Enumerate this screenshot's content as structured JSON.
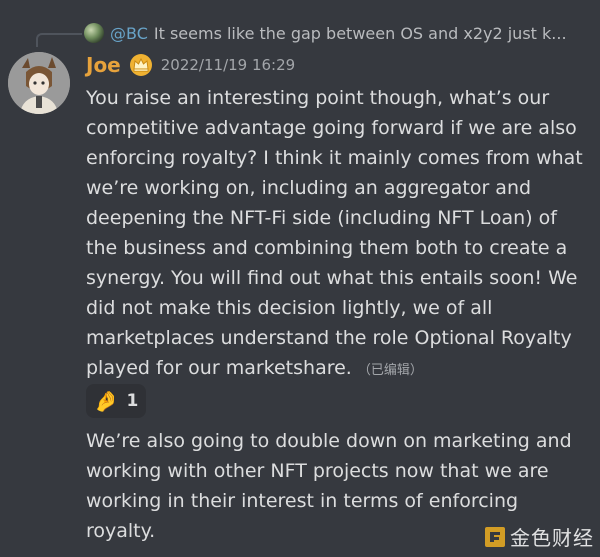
{
  "reply": {
    "user": "@BC",
    "text": "It seems like the gap between OS and x2y2 just k..."
  },
  "message": {
    "username": "Joe",
    "timestamp": "2022/11/19 16:29",
    "text": "You raise an interesting point though, what’s our competitive advantage going forward if we are also enforcing royalty? I think it mainly comes from what we’re working on, including an aggregator and deepening the NFT-Fi side (including NFT Loan) of the business and combining them both to create a synergy. You will find out what this entails soon! We did not make this decision lightly, we of all marketplaces understand the role Optional Royalty played for our marketshare.",
    "edited_label": "（已编辑）"
  },
  "reaction": {
    "emoji": "🤌",
    "count": "1"
  },
  "message2": {
    "text": "We’re also going to double down on marketing and working with other NFT projects now that we are working in their interest in terms of enforcing royalty."
  },
  "watermark": {
    "text": "金色财经"
  },
  "colors": {
    "background": "#36393f",
    "username": "#e6a23c",
    "mention": "#68a3c8",
    "text": "#dcddde",
    "muted": "#a3a6aa"
  },
  "icons": {
    "crown": "crown-icon",
    "reply_avatar": "avatar-icon",
    "watermark_logo": "jinse-logo-icon"
  }
}
